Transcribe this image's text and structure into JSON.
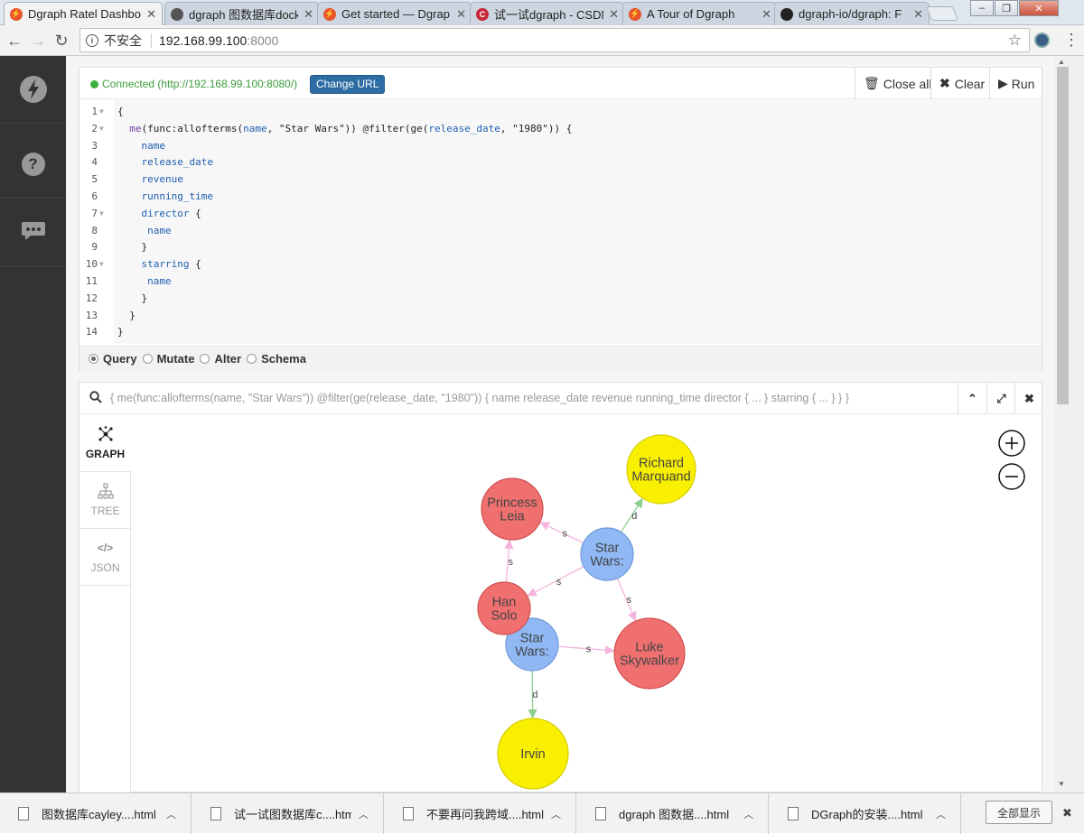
{
  "browser": {
    "tabs": [
      {
        "title": "Dgraph Ratel Dashbo",
        "favicon": "dgraph-icon",
        "color": "#e8542b",
        "active": true
      },
      {
        "title": "dgraph 图数据库dock",
        "favicon": "github-icon",
        "color": "#555555",
        "active": false
      },
      {
        "title": "Get started — Dgrap",
        "favicon": "dgraph-icon",
        "color": "#e8542b",
        "active": false
      },
      {
        "title": "试一试dgraph - CSDN",
        "favicon": "csdn-icon",
        "color": "#c7283a",
        "active": false
      },
      {
        "title": "A Tour of Dgraph",
        "favicon": "dgraph-icon",
        "color": "#e8542b",
        "active": false
      },
      {
        "title": "dgraph-io/dgraph: F",
        "favicon": "github-icon",
        "color": "#222222",
        "active": false
      }
    ],
    "address": {
      "security_label": "不安全",
      "host": "192.168.99.100",
      "port": ":8000"
    }
  },
  "sidebar": {
    "items": [
      {
        "name": "dgraph-logo-icon",
        "glyph": "⚡"
      },
      {
        "name": "help-icon",
        "glyph": "?"
      },
      {
        "name": "chat-icon",
        "glyph": "•••"
      }
    ]
  },
  "editor": {
    "connection": "Connected (http://192.168.99.100:8080/)",
    "change_url": "Change URL",
    "buttons": {
      "close_all": "Close all",
      "clear": "Clear",
      "run": "Run"
    },
    "lines": [
      "{",
      "  me(func:allofterms(name, \"Star Wars\")) @filter(ge(release_date, \"1980\")) {",
      "    name",
      "    release_date",
      "    revenue",
      "    running_time",
      "    director {",
      "     name",
      "    }",
      "    starring {",
      "     name",
      "    }",
      "  }",
      "}"
    ],
    "query_types": [
      {
        "label": "Query",
        "selected": true
      },
      {
        "label": "Mutate",
        "selected": false
      },
      {
        "label": "Alter",
        "selected": false
      },
      {
        "label": "Schema",
        "selected": false
      }
    ]
  },
  "frame": {
    "query": "{ me(func:allofterms(name, \"Star Wars\")) @filter(ge(release_date, \"1980\")) { name release_date revenue running_time director { ... } starring { ... } } }",
    "tabs": [
      {
        "label": "GRAPH",
        "icon": "graph-icon",
        "active": true
      },
      {
        "label": "TREE",
        "icon": "tree-icon",
        "active": false
      },
      {
        "label": "JSON",
        "icon": "code-icon",
        "active": false
      }
    ],
    "graph": {
      "nodes": [
        {
          "id": "sw1",
          "label": [
            "Star",
            "Wars:"
          ],
          "color": "#8fb8f5"
        },
        {
          "id": "sw2",
          "label": [
            "Star",
            "Wars:"
          ],
          "color": "#8fb8f5"
        },
        {
          "id": "leia",
          "label": [
            "Princess",
            "Leia"
          ],
          "color": "#f07070"
        },
        {
          "id": "han",
          "label": [
            "Han",
            "Solo"
          ],
          "color": "#f07070"
        },
        {
          "id": "luke",
          "label": [
            "Luke",
            "Skywalker"
          ],
          "color": "#f07070"
        },
        {
          "id": "richard",
          "label": [
            "Richard",
            "Marquand"
          ],
          "color": "#f8f000"
        },
        {
          "id": "irvin",
          "label": [
            "Irvin"
          ],
          "color": "#f8f000"
        }
      ],
      "edges": [
        {
          "from": "sw1",
          "to": "richard",
          "label": "d",
          "color": "#8ed08e"
        },
        {
          "from": "sw1",
          "to": "leia",
          "label": "s",
          "color": "#f3b5dc"
        },
        {
          "from": "sw1",
          "to": "han",
          "label": "s",
          "color": "#f3b5dc"
        },
        {
          "from": "sw1",
          "to": "luke",
          "label": "s",
          "color": "#f3b5dc"
        },
        {
          "from": "han",
          "to": "leia",
          "label": "s",
          "color": "#f3b5dc"
        },
        {
          "from": "sw2",
          "to": "han",
          "label": "s",
          "color": "#f3b5dc"
        },
        {
          "from": "sw2",
          "to": "luke",
          "label": "s",
          "color": "#f3b5dc"
        },
        {
          "from": "sw2",
          "to": "irvin",
          "label": "d",
          "color": "#8ed08e"
        }
      ]
    }
  },
  "downloads": {
    "items": [
      "图数据库cayley....html",
      "试一试图数据库c....html",
      "不要再问我跨域....html",
      "dgraph 图数据....html",
      "DGraph的安装....html"
    ],
    "show_all": "全部显示"
  }
}
